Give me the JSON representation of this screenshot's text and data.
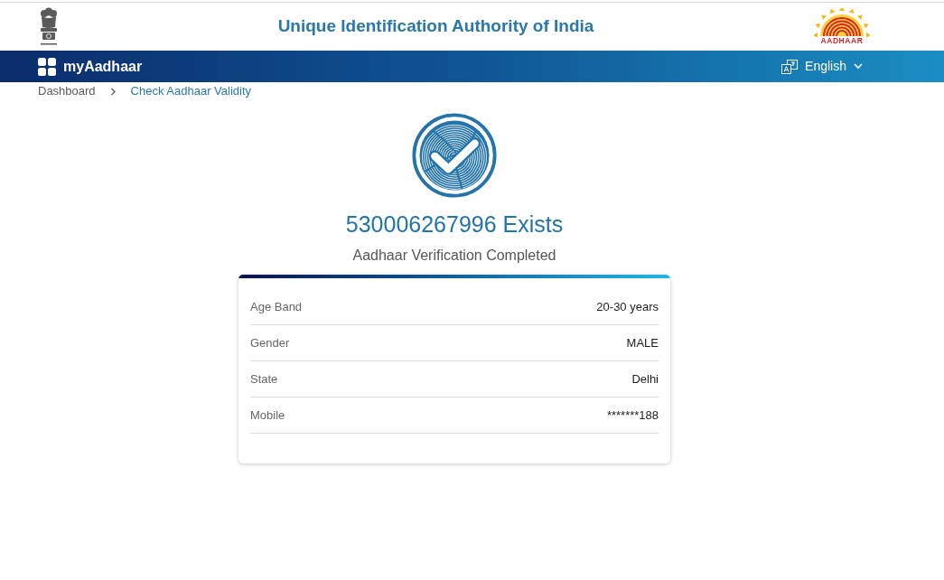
{
  "header": {
    "title": "Unique Identification Authority of India",
    "logo_text": "AADHAAR"
  },
  "navbar": {
    "brand": "myAadhaar",
    "language": "English"
  },
  "breadcrumb": [
    {
      "label": "Dashboard",
      "selected": false
    },
    {
      "label": "Check Aadhaar Validity",
      "selected": true
    }
  ],
  "result": {
    "heading": "530006267996 Exists",
    "subtitle": "Aadhaar Verification Completed"
  },
  "details": [
    {
      "label": "Age Band",
      "value": "20-30 years"
    },
    {
      "label": "Gender",
      "value": "MALE"
    },
    {
      "label": "State",
      "value": "Delhi"
    },
    {
      "label": "Mobile",
      "value": "*******188"
    }
  ]
}
